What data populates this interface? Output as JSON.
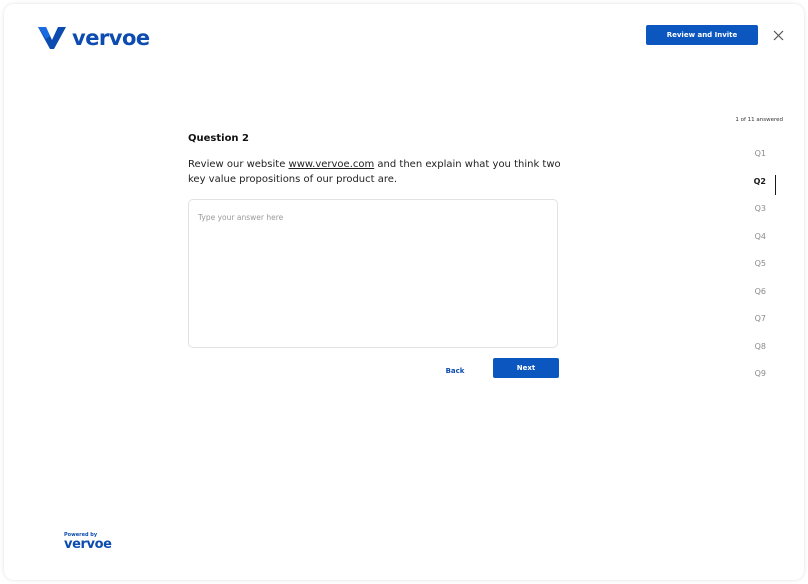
{
  "header": {
    "brand": "vervoe",
    "review_button": "Review and Invite"
  },
  "progress": {
    "answered_text": "1 of 11 answered"
  },
  "nav": {
    "items": [
      "Q1",
      "Q2",
      "Q3",
      "Q4",
      "Q5",
      "Q6",
      "Q7",
      "Q8",
      "Q9"
    ],
    "active": "Q2"
  },
  "question": {
    "title": "Question 2",
    "text_before": "Review our website ",
    "link": "www.vervoe.com",
    "text_after": " and then explain what you think two key value propositions of our product are."
  },
  "answer": {
    "placeholder": "Type your answer here",
    "value": ""
  },
  "actions": {
    "back": "Back",
    "next": "Next"
  },
  "footer": {
    "powered_by": "Powered by",
    "brand": "vervoe"
  },
  "colors": {
    "brand": "#0c4bb0",
    "button": "#0c56c0"
  }
}
